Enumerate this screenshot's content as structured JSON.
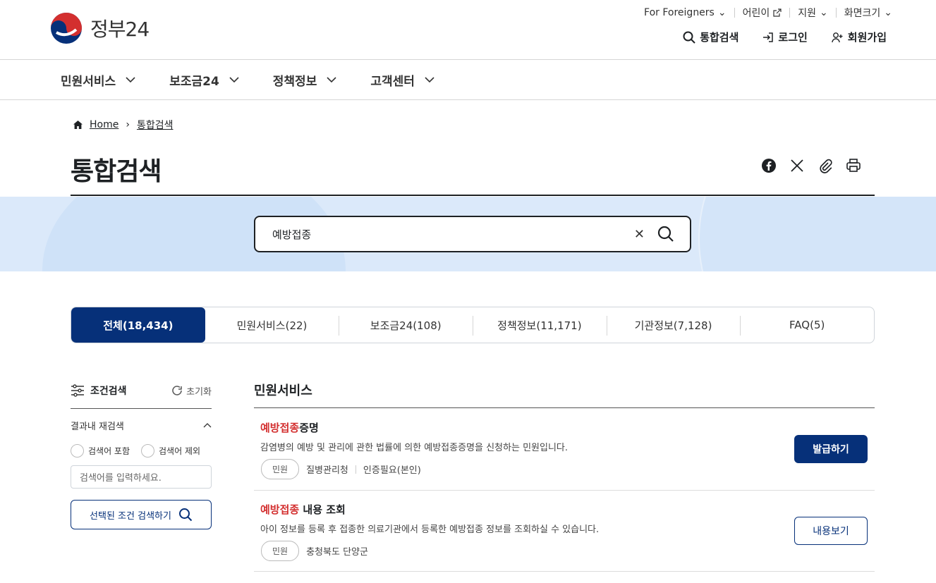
{
  "header": {
    "logo_text": "정부24",
    "util": [
      {
        "label": "For Foreigners",
        "icon": "chevron-down-icon"
      },
      {
        "label": "어린이",
        "icon": "external-link-icon"
      },
      {
        "label": "지원",
        "icon": "chevron-down-icon"
      },
      {
        "label": "화면크기",
        "icon": "chevron-down-icon"
      }
    ],
    "actions": {
      "search": "통합검색",
      "login": "로그인",
      "signup": "회원가입"
    },
    "colors": {
      "brand": "#063079",
      "highlight": "#d32f2f"
    }
  },
  "nav": [
    "민원서비스",
    "보조금24",
    "정책정보",
    "고객센터"
  ],
  "breadcrumb": {
    "home": "Home",
    "current": "통합검색"
  },
  "page": {
    "title": "통합검색"
  },
  "search": {
    "value": "예방접종"
  },
  "tabs": [
    "전체(18,434)",
    "민원서비스(22)",
    "보조금24(108)",
    "정책정보(11,171)",
    "기관정보(7,128)",
    "FAQ(5)"
  ],
  "filter": {
    "title": "조건검색",
    "reset": "초기화",
    "sub_title": "결과내 재검색",
    "include": "검색어 포함",
    "exclude": "검색어 제외",
    "input_placeholder": "검색어를 입력하세요.",
    "submit": "선택된 조건 검색하기"
  },
  "results": {
    "section_title": "민원서비스",
    "items": [
      {
        "title_hl": "예방접종",
        "title_rest": "증명",
        "desc": "감염병의 예방 및 관리에 관한 법률에 의한 예방접종증명을 신청하는 민원입니다.",
        "badge": "민원",
        "agency": "질병관리청",
        "extra": "인증필요(본인)",
        "button": "발급하기"
      },
      {
        "title_hl": "예방접종",
        "title_rest": " 내용 조회",
        "desc": "아이 정보를 등록 후 접종한 의료기관에서 등록한 예방접종 정보를 조회하실 수 있습니다.",
        "badge": "민원",
        "agency": "충청북도 단양군",
        "button": "내용보기"
      }
    ]
  }
}
